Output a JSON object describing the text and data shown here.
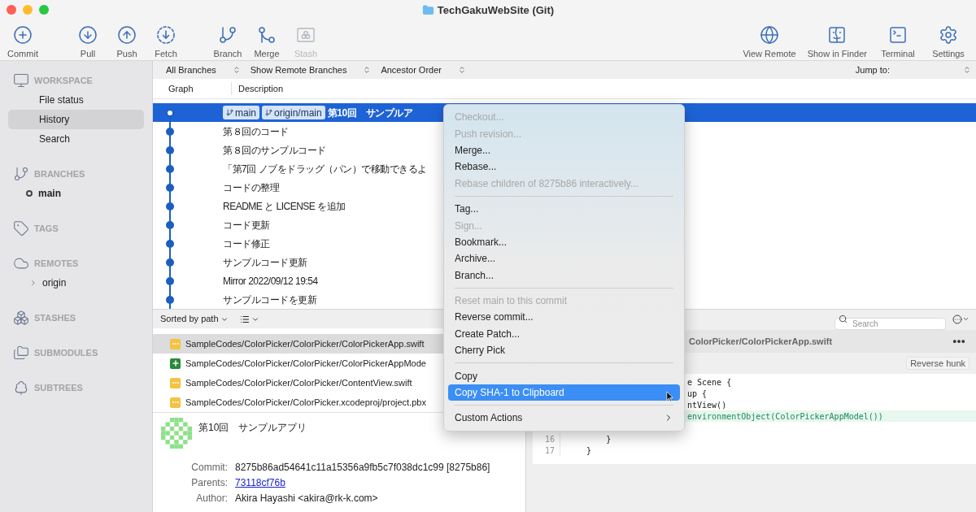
{
  "window": {
    "title": "TechGakuWebSite (Git)"
  },
  "toolbar": {
    "groups": [
      [
        {
          "label": "Commit",
          "disabled": false
        }
      ],
      [
        {
          "label": "Pull",
          "disabled": false
        },
        {
          "label": "Push",
          "disabled": false
        },
        {
          "label": "Fetch",
          "disabled": false
        }
      ],
      [
        {
          "label": "Branch",
          "disabled": false
        },
        {
          "label": "Merge",
          "disabled": false
        },
        {
          "label": "Stash",
          "disabled": true
        }
      ]
    ],
    "right": [
      {
        "label": "View Remote",
        "disabled": false
      },
      {
        "label": "Show in Finder",
        "disabled": false
      },
      {
        "label": "Terminal",
        "disabled": false
      },
      {
        "label": "Settings",
        "disabled": false
      }
    ]
  },
  "sidebar": {
    "sections": [
      {
        "title": "WORKSPACE",
        "items": [
          {
            "label": "File status",
            "kind": "page",
            "selected": false
          },
          {
            "label": "History",
            "kind": "page",
            "selected": true
          },
          {
            "label": "Search",
            "kind": "page",
            "selected": false
          }
        ]
      },
      {
        "title": "BRANCHES",
        "items": [
          {
            "label": "main",
            "kind": "branch",
            "current": true,
            "selected": false
          }
        ]
      },
      {
        "title": "TAGS"
      },
      {
        "title": "REMOTES",
        "items": [
          {
            "label": "origin",
            "kind": "remote",
            "expanded": false,
            "selected": false
          }
        ]
      },
      {
        "title": "STASHES"
      },
      {
        "title": "SUBMODULES"
      },
      {
        "title": "SUBTREES"
      }
    ]
  },
  "filters": [
    {
      "label": "All Branches"
    },
    {
      "label": "Show Remote Branches"
    },
    {
      "label": "Ancestor Order"
    }
  ],
  "jump_to": {
    "label": "Jump to:"
  },
  "columns": [
    "Graph",
    "Description"
  ],
  "commits": [
    {
      "description": "第10回　サンプルア",
      "selected": true,
      "refs": [
        "main",
        "origin/main"
      ]
    },
    {
      "description": "第８回のコード",
      "selected": false
    },
    {
      "description": "第８回のサンプルコード",
      "selected": false
    },
    {
      "description": "「第7回 ノブをドラッグ（パン）で移動できるよ",
      "selected": false
    },
    {
      "description": "コードの整理",
      "selected": false
    },
    {
      "description": "README と LICENSE を追加",
      "selected": false
    },
    {
      "description": "コード更新",
      "selected": false
    },
    {
      "description": "コード修正",
      "selected": false
    },
    {
      "description": "サンプルコード更新",
      "selected": false
    },
    {
      "description": "Mirror 2022/09/12 19:54",
      "selected": false
    },
    {
      "description": "サンプルコードを更新",
      "selected": false
    }
  ],
  "files_toolbar": {
    "sort": "Sorted by path"
  },
  "files": [
    {
      "path": "SampleCodes/ColorPicker/ColorPicker/ColorPickerApp.swift",
      "kind": "modified",
      "selected": true
    },
    {
      "path": "SampleCodes/ColorPicker/ColorPicker/ColorPickerAppMode",
      "kind": "added",
      "selected": false
    },
    {
      "path": "SampleCodes/ColorPicker/ColorPicker/ContentView.swift",
      "kind": "modified",
      "selected": false
    },
    {
      "path": "SampleCodes/ColorPicker/ColorPicker.xcodeproj/project.pbx",
      "kind": "modified",
      "selected": false
    }
  ],
  "details": {
    "title": "第10回　サンプルアプリ",
    "fields": [
      {
        "label": "Commit:",
        "value": "8275b86ad54641c11a15356a9fb5c7f038dc1c99 [8275b86]",
        "kind": "text"
      },
      {
        "label": "Parents:",
        "value": "73118cf76b",
        "kind": "link"
      },
      {
        "label": "Author:",
        "value": "Akira Hayashi <akira@rk-k.com>",
        "kind": "text"
      }
    ]
  },
  "diff": {
    "search": {
      "placeholder": "Search"
    },
    "file": "ColorPicker/ColorPickerApp.swift",
    "hunk_button": "Reverse hunk",
    "lines": [
      {
        "text": "e Scene {",
        "kind": "context"
      },
      {
        "text": "up {",
        "kind": "context"
      },
      {
        "text": "ntView()",
        "kind": "context"
      },
      {
        "text": "environmentObject(ColorPickerAppModel())",
        "kind": "added"
      },
      {
        "number": "16",
        "text": "        }",
        "kind": "context"
      },
      {
        "number": "17",
        "text": "    }",
        "kind": "context"
      }
    ]
  },
  "context_menu": {
    "items": [
      {
        "label": "Checkout...",
        "kind": "item",
        "disabled": true,
        "selected": false
      },
      {
        "label": "Push revision...",
        "kind": "item",
        "disabled": true,
        "selected": false
      },
      {
        "label": "Merge...",
        "kind": "item",
        "disabled": false,
        "selected": false
      },
      {
        "label": "Rebase...",
        "kind": "item",
        "disabled": false,
        "selected": false
      },
      {
        "label": "Rebase children of 8275b86 interactively...",
        "kind": "item",
        "disabled": true,
        "selected": false
      },
      {
        "kind": "separator"
      },
      {
        "label": "Tag...",
        "kind": "item",
        "disabled": false,
        "selected": false
      },
      {
        "label": "Sign...",
        "kind": "item",
        "disabled": true,
        "selected": false
      },
      {
        "label": "Bookmark...",
        "kind": "item",
        "disabled": false,
        "selected": false
      },
      {
        "label": "Archive...",
        "kind": "item",
        "disabled": false,
        "selected": false
      },
      {
        "label": "Branch...",
        "kind": "item",
        "disabled": false,
        "selected": false
      },
      {
        "kind": "separator"
      },
      {
        "label": "Reset main to this commit",
        "kind": "item",
        "disabled": true,
        "selected": false
      },
      {
        "label": "Reverse commit...",
        "kind": "item",
        "disabled": false,
        "selected": false
      },
      {
        "label": "Create Patch...",
        "kind": "item",
        "disabled": false,
        "selected": false
      },
      {
        "label": "Cherry Pick",
        "kind": "item",
        "disabled": false,
        "selected": false
      },
      {
        "kind": "separator"
      },
      {
        "label": "Copy",
        "kind": "item",
        "disabled": false,
        "selected": false
      },
      {
        "label": "Copy SHA-1 to Clipboard",
        "kind": "item",
        "disabled": false,
        "selected": true
      },
      {
        "kind": "separator"
      },
      {
        "label": "Custom Actions",
        "kind": "submenu",
        "disabled": false,
        "selected": false
      }
    ]
  }
}
